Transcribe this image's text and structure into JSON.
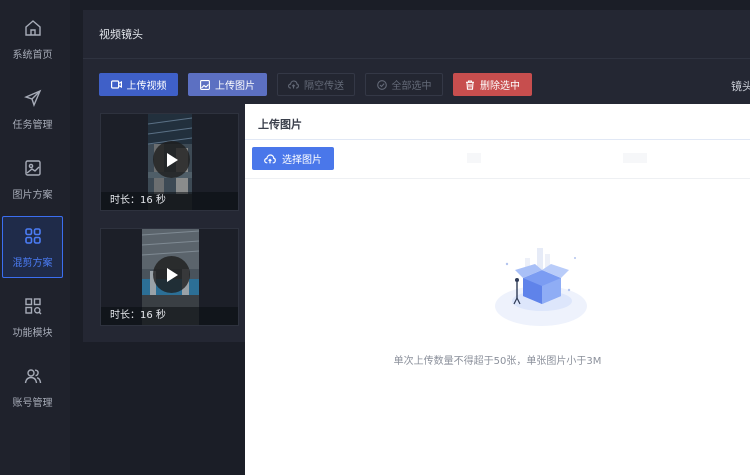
{
  "sidebar": {
    "items": [
      {
        "label": "系统首页",
        "icon": "home-icon",
        "active": false
      },
      {
        "label": "任务管理",
        "icon": "send-icon",
        "active": false
      },
      {
        "label": "图片方案",
        "icon": "image-icon",
        "active": false
      },
      {
        "label": "混剪方案",
        "icon": "grid-icon",
        "active": true
      },
      {
        "label": "功能模块",
        "icon": "modules-icon",
        "active": false
      },
      {
        "label": "账号管理",
        "icon": "users-icon",
        "active": false
      }
    ],
    "active_color": "#4b7cf5"
  },
  "panel": {
    "title": "视频镜头",
    "toolbar": {
      "upload_video": "上传视频",
      "upload_image": "上传图片",
      "transfer": "隔空传送",
      "select_all": "全部选中",
      "delete_selected": "删除选中"
    },
    "lens_label": "镜头"
  },
  "videos": [
    {
      "duration": "时长：16 秒"
    },
    {
      "duration": "时长：16 秒"
    }
  ],
  "modal": {
    "title": "上传图片",
    "pick_button": "选择图片",
    "hint": "单次上传数量不得超于50张，单张图片小于3M"
  },
  "colors": {
    "primary": "#3f60c8",
    "danger": "#c74e4e",
    "pick": "#4a77ea"
  }
}
